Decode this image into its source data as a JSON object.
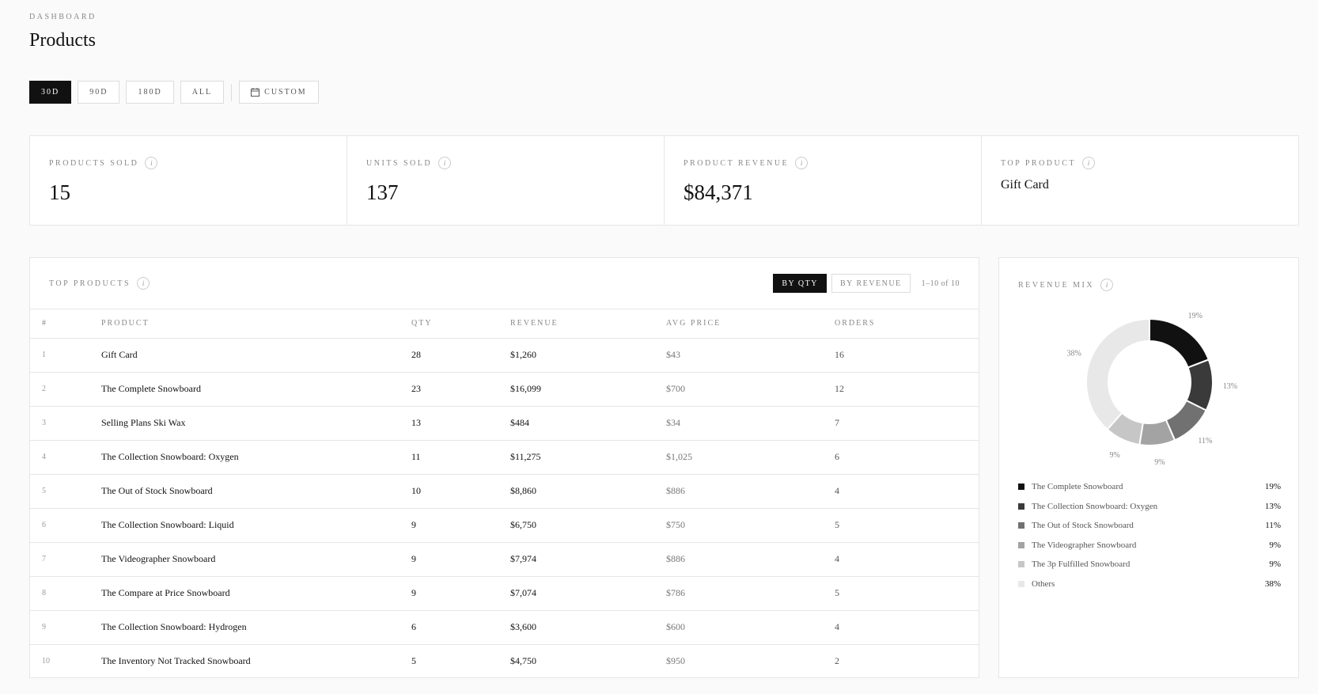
{
  "header": {
    "eyebrow": "DASHBOARD",
    "title": "Products"
  },
  "ranges": [
    {
      "label": "30D",
      "active": true
    },
    {
      "label": "90D",
      "active": false
    },
    {
      "label": "180D",
      "active": false
    },
    {
      "label": "ALL",
      "active": false
    }
  ],
  "custom": {
    "label": "CUSTOM",
    "icon": "calendar-icon"
  },
  "kpis": {
    "products_sold": {
      "label": "PRODUCTS SOLD",
      "value": "15"
    },
    "units_sold": {
      "label": "UNITS SOLD",
      "value": "137"
    },
    "product_revenue": {
      "label": "PRODUCT REVENUE",
      "value": "$84,371"
    },
    "top_product": {
      "label": "TOP PRODUCT",
      "value": "Gift Card"
    }
  },
  "info_glyph": "i",
  "top_products": {
    "title": "TOP PRODUCTS",
    "sort_qty": "BY QTY",
    "sort_revenue": "BY REVENUE",
    "pager": "1–10 of 10",
    "columns": [
      "#",
      "PRODUCT",
      "QTY",
      "REVENUE",
      "AVG PRICE",
      "ORDERS"
    ],
    "rows": [
      {
        "idx": "1",
        "product": "Gift Card",
        "qty": "28",
        "revenue": "$1,260",
        "avg": "$43",
        "orders": "16"
      },
      {
        "idx": "2",
        "product": "The Complete Snowboard",
        "qty": "23",
        "revenue": "$16,099",
        "avg": "$700",
        "orders": "12"
      },
      {
        "idx": "3",
        "product": "Selling Plans Ski Wax",
        "qty": "13",
        "revenue": "$484",
        "avg": "$34",
        "orders": "7"
      },
      {
        "idx": "4",
        "product": "The Collection Snowboard: Oxygen",
        "qty": "11",
        "revenue": "$11,275",
        "avg": "$1,025",
        "orders": "6"
      },
      {
        "idx": "5",
        "product": "The Out of Stock Snowboard",
        "qty": "10",
        "revenue": "$8,860",
        "avg": "$886",
        "orders": "4"
      },
      {
        "idx": "6",
        "product": "The Collection Snowboard: Liquid",
        "qty": "9",
        "revenue": "$6,750",
        "avg": "$750",
        "orders": "5"
      },
      {
        "idx": "7",
        "product": "The Videographer Snowboard",
        "qty": "9",
        "revenue": "$7,974",
        "avg": "$886",
        "orders": "4"
      },
      {
        "idx": "8",
        "product": "The Compare at Price Snowboard",
        "qty": "9",
        "revenue": "$7,074",
        "avg": "$786",
        "orders": "5"
      },
      {
        "idx": "9",
        "product": "The Collection Snowboard: Hydrogen",
        "qty": "6",
        "revenue": "$3,600",
        "avg": "$600",
        "orders": "4"
      },
      {
        "idx": "10",
        "product": "The Inventory Not Tracked Snowboard",
        "qty": "5",
        "revenue": "$4,750",
        "avg": "$950",
        "orders": "2"
      }
    ]
  },
  "revenue_mix": {
    "title": "REVENUE MIX"
  },
  "chart_data": {
    "type": "pie",
    "series": [
      {
        "name": "The Complete Snowboard",
        "value": 19,
        "label": "19%",
        "color": "#111111"
      },
      {
        "name": "The Collection Snowboard: Oxygen",
        "value": 13,
        "label": "13%",
        "color": "#3a3a3a"
      },
      {
        "name": "The Out of Stock Snowboard",
        "value": 11,
        "label": "11%",
        "color": "#717171"
      },
      {
        "name": "The Videographer Snowboard",
        "value": 9,
        "label": "9%",
        "color": "#a3a3a3"
      },
      {
        "name": "The 3p Fulfilled Snowboard",
        "value": 9,
        "label": "9%",
        "color": "#c6c6c6"
      },
      {
        "name": "Others",
        "value": 38,
        "label": "38%",
        "color": "#e8e8e8"
      }
    ]
  }
}
